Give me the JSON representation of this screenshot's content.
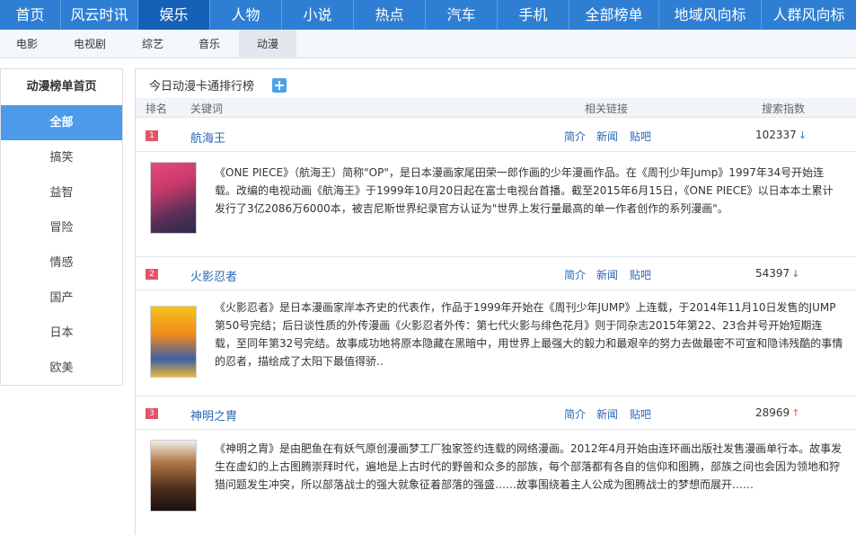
{
  "topnav": [
    "首页",
    "风云时讯",
    "娱乐",
    "人物",
    "小说",
    "热点",
    "汽车",
    "手机",
    "全部榜单",
    "地域风向标",
    "人群风向标"
  ],
  "subnav": [
    "电影",
    "电视剧",
    "综艺",
    "音乐",
    "动漫"
  ],
  "sidebar": {
    "title": "动漫榜单首页",
    "items": [
      "全部",
      "搞笑",
      "益智",
      "冒险",
      "情感",
      "国产",
      "日本",
      "欧美"
    ]
  },
  "main": {
    "title": "今日动漫卡通排行榜",
    "columns": {
      "rank": "排名",
      "keyword": "关键词",
      "links": "相关链接",
      "index": "搜索指数"
    },
    "rows": [
      {
        "rank": "1",
        "keyword": "航海王",
        "links": [
          "简介",
          "新闻",
          "贴吧"
        ],
        "index": "102337",
        "trend": "↓",
        "description": "《ONE PIECE》（航海王）简称\"OP\"，是日本漫画家尾田荣一郎作画的少年漫画作品。在《周刊少年Jump》1997年34号开始连载。改编的电视动画《航海王》于1999年10月20日起在富士电视台首播。截至2015年6月15日，《ONE PIECE》以日本本土累计发行了3亿2086万6000本，被吉尼斯世界纪录官方认证为\"世界上发行量最高的单一作者创作的系列漫画\"。"
      },
      {
        "rank": "2",
        "keyword": "火影忍者",
        "links": [
          "简介",
          "新闻",
          "贴吧"
        ],
        "index": "54397",
        "trend": "↓",
        "description": "《火影忍者》是日本漫画家岸本齐史的代表作，作品于1999年开始在《周刊少年JUMP》上连载，于2014年11月10日发售的JUMP第50号完结；后日谈性质的外传漫画《火影忍者外传：第七代火影与绯色花月》则于同杂志2015年第22、23合并号开始短期连载，至同年第32号完结。故事成功地将原本隐藏在黑暗中，用世界上最强大的毅力和最艰辛的努力去做最密不可宣和隐讳残酷的事情的忍者，描绘成了太阳下最值得骄.."
      },
      {
        "rank": "3",
        "keyword": "神明之胄",
        "links": [
          "简介",
          "新闻",
          "贴吧"
        ],
        "index": "28969",
        "trend": "↑",
        "description": "《神明之胄》是由肥鱼在有妖气原创漫画梦工厂独家签约连载的网络漫画。2012年4月开始由连环画出版社发售漫画单行本。故事发生在虚幻的上古图腾崇拜时代，遍地是上古时代的野兽和众多的部族，每个部落都有各自的信仰和图腾，部族之间也会因为领地和狩猎问题发生冲突，所以部落战士的强大就象征着部落的强盛……故事围绕着主人公成为图腾战士的梦想而展开……"
      }
    ]
  },
  "colors": {
    "nav": "#2e7fd3",
    "nav_active": "#1561b8",
    "side_active": "#4d9be8",
    "rank_badge": "#e3536b",
    "link": "#2a66b5"
  }
}
